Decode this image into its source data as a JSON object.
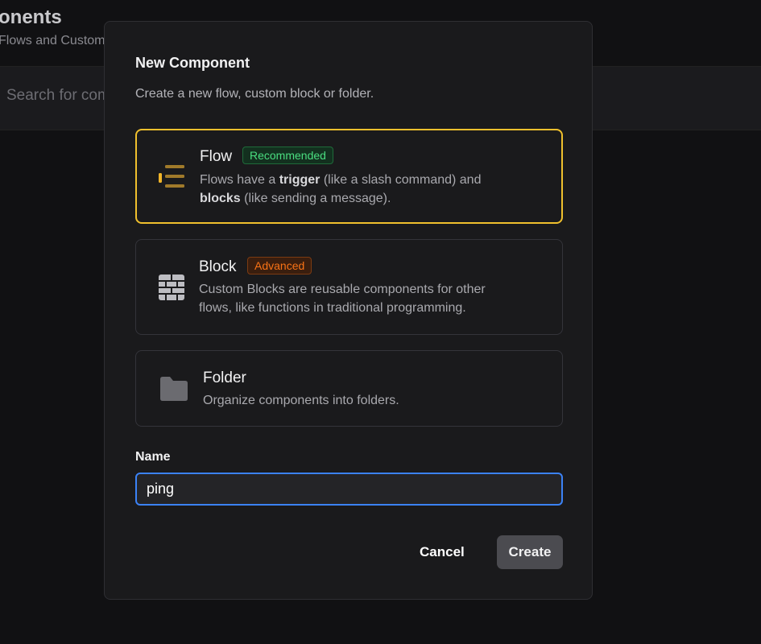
{
  "background": {
    "page_title": "onents",
    "page_subtitle": "Flows and Custom",
    "search_placeholder": "Search for com"
  },
  "dialog": {
    "title": "New Component",
    "description": "Create a new flow, custom block or folder.",
    "options": [
      {
        "name": "Flow",
        "badge": "Recommended",
        "icon": "list-icon",
        "selected": true,
        "desc_line1_a": "Flows have a ",
        "desc_line1_bold": "trigger",
        "desc_line1_b": " (like a slash command) and",
        "desc_line2_bold": "blocks",
        "desc_line2_b": " (like sending a message)."
      },
      {
        "name": "Block",
        "badge": "Advanced",
        "icon": "brick-wall-icon",
        "selected": false,
        "desc_line1": "Custom Blocks are reusable components for other",
        "desc_line2": "flows, like functions in traditional programming."
      },
      {
        "name": "Folder",
        "icon": "folder-icon",
        "selected": false,
        "desc_line1": "Organize components into folders."
      }
    ],
    "name_label": "Name",
    "name_value": "ping",
    "cancel_label": "Cancel",
    "create_label": "Create"
  },
  "colors": {
    "selected_border": "#f0c02d",
    "input_focus": "#3b82f6",
    "badge_recommended": "#4ade80",
    "badge_advanced": "#f97316"
  }
}
